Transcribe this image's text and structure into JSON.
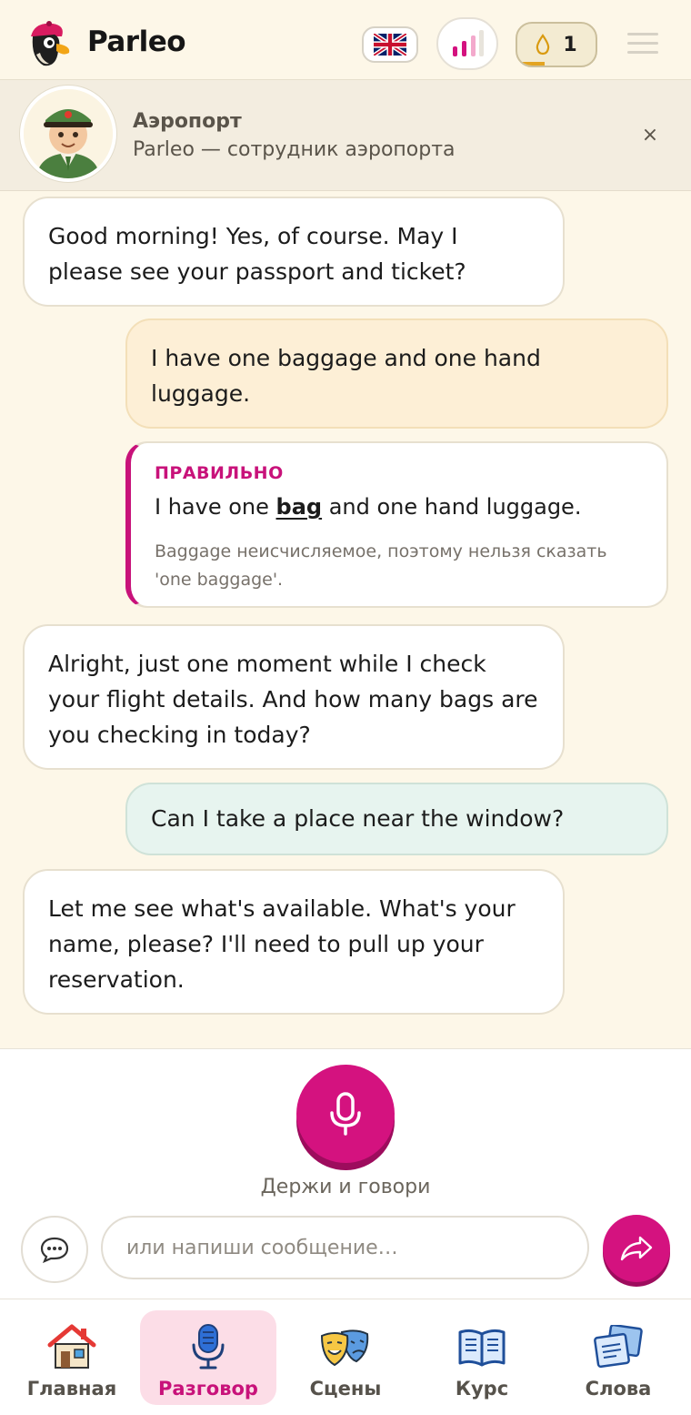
{
  "header": {
    "brand": "Parleo",
    "language_flag": "uk-flag-icon",
    "level_icon": "level-bars-icon",
    "coins": "1",
    "menu_icon": "hamburger-menu-icon"
  },
  "scene": {
    "title": "Аэропорт",
    "subtitle": "Parleo — сотрудник аэропорта",
    "close_label": "×"
  },
  "messages": [
    {
      "role": "bot",
      "text": "Good morning! Yes, of course. May I please see your passport and ticket?"
    },
    {
      "role": "user",
      "status": "warning",
      "text": "I have one baggage and one hand luggage."
    },
    {
      "role": "correction",
      "label": "ПРАВИЛЬНО",
      "before": "I have one ",
      "highlight": "bag",
      "after": " and one hand luggage.",
      "note": "Baggage неисчисляемое, поэтому нельзя сказать 'one baggage'."
    },
    {
      "role": "bot",
      "text": "Alright, just one moment while I check your flight details. And how many bags are you checking in today?"
    },
    {
      "role": "user",
      "status": "ok",
      "text": "Can I take a place near the window?"
    },
    {
      "role": "bot",
      "text": "Let me see what's available. What's your name, please? I'll need to pull up your reservation."
    }
  ],
  "composer": {
    "hold_label": "Держи и говори",
    "input_placeholder": "или напиши сообщение…",
    "input_value": ""
  },
  "nav": {
    "items": [
      {
        "label": "Главная",
        "icon": "home-icon"
      },
      {
        "label": "Разговор",
        "icon": "microphone-icon",
        "active": true
      },
      {
        "label": "Сцены",
        "icon": "theater-masks-icon"
      },
      {
        "label": "Курс",
        "icon": "book-icon"
      },
      {
        "label": "Слова",
        "icon": "word-cards-icon"
      }
    ]
  },
  "colors": {
    "accent": "#d4127f",
    "background": "#fdf7e8",
    "warning_bubble": "#fdefd6",
    "ok_bubble": "#e7f4ef"
  }
}
